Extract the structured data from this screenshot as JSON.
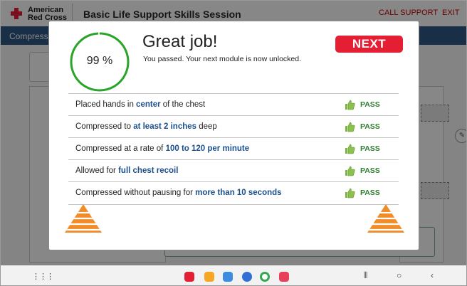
{
  "header": {
    "logo_line1": "American",
    "logo_line2": "Red Cross",
    "title": "Basic Life Support Skills Session",
    "call_support": "CALL SUPPORT",
    "exit": "EXIT"
  },
  "appbar": {
    "label": "Compress"
  },
  "modal": {
    "score_text": "99 %",
    "score_value": 99,
    "title": "Great job!",
    "subtitle": "You passed. Your next module is now unlocked.",
    "next_label": "NEXT",
    "results": [
      {
        "pre": "Placed hands in ",
        "hl": "center",
        "post": " of the chest",
        "status": "PASS"
      },
      {
        "pre": "Compressed to ",
        "hl": "at least 2 inches",
        "post": " deep",
        "status": "PASS"
      },
      {
        "pre": "Compressed at a rate of ",
        "hl": "100 to 120 per minute",
        "post": "",
        "status": "PASS"
      },
      {
        "pre": "Allowed for ",
        "hl": "full chest recoil",
        "post": "",
        "status": "PASS"
      },
      {
        "pre": "Compressed without pausing for ",
        "hl": "more than 10 seconds",
        "post": "",
        "status": "PASS"
      }
    ]
  },
  "colors": {
    "accent_red": "#e41f34",
    "pass_green": "#2e7d32",
    "ring_green": "#2aa52a",
    "highlight_blue": "#1b4f8f",
    "arrow_orange": "#f28c28"
  },
  "icons": {
    "thumbs_up": "thumbs-up-icon",
    "arrow_left": "left-arrow-icon",
    "arrow_right": "right-arrow-icon"
  }
}
